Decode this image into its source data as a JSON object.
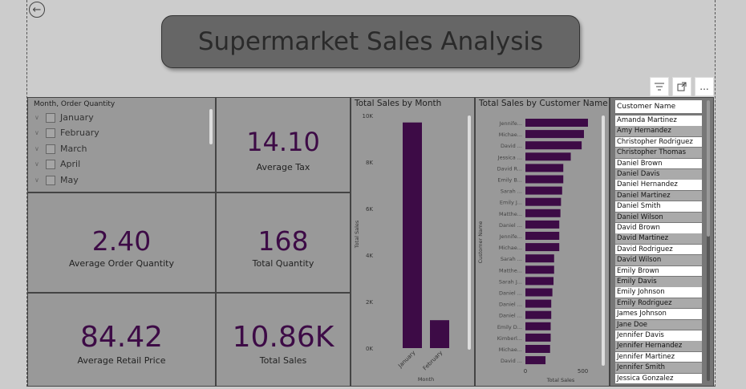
{
  "title": "Supermarket Sales Analysis",
  "header_tools": {
    "filter_icon": "filter-icon",
    "focus_icon": "focus-mode-icon",
    "more_icon": "ellipsis-icon",
    "more_label": "..."
  },
  "back_icon": "back-arrow-icon",
  "slicer": {
    "title": "Month, Order Quantity",
    "items": [
      "January",
      "February",
      "March",
      "April",
      "May"
    ]
  },
  "kpis": {
    "avg_tax": {
      "value": "14.10",
      "label": "Average Tax"
    },
    "avg_order_qty": {
      "value": "2.40",
      "label": "Average Order Quantity"
    },
    "total_qty": {
      "value": "168",
      "label": "Total Quantity"
    },
    "avg_retail_price": {
      "value": "84.42",
      "label": "Average Retail Price"
    },
    "total_sales": {
      "value": "10.86K",
      "label": "Total Sales"
    }
  },
  "colors": {
    "bar": "#3d0b46",
    "tile": "#999999",
    "background": "#cccccc"
  },
  "chart_data": [
    {
      "type": "bar",
      "title": "Total Sales by Month",
      "xlabel": "Month",
      "ylabel": "Total Sales",
      "categories": [
        "January",
        "February"
      ],
      "values": [
        9700,
        1200
      ],
      "yticks": [
        "0K",
        "2K",
        "4K",
        "6K",
        "8K",
        "10K"
      ],
      "ylim": [
        0,
        10000
      ],
      "grid": false
    },
    {
      "type": "bar",
      "orientation": "horizontal",
      "title": "Total Sales by Customer Name",
      "xlabel": "Total Sales",
      "ylabel": "Customer Name",
      "categories": [
        "Jennife...",
        "Michae...",
        "David ...",
        "Jessica ...",
        "David R...",
        "Emily B...",
        "Sarah ...",
        "Emily J...",
        "Matthe...",
        "Daniel ...",
        "Jennife...",
        "Michae...",
        "Sarah ...",
        "Matthe...",
        "Sarah J...",
        "Daniel ...",
        "Daniel ...",
        "Daniel ...",
        "Emily D...",
        "Kimberl...",
        "Michae...",
        "David ..."
      ],
      "values": [
        545,
        510,
        490,
        395,
        330,
        330,
        320,
        310,
        305,
        295,
        295,
        295,
        250,
        250,
        245,
        235,
        225,
        225,
        220,
        220,
        215,
        175
      ],
      "xticks": [
        "0",
        "500"
      ],
      "xlim": [
        0,
        580
      ],
      "grid": false
    }
  ],
  "table": {
    "header": "Customer Name",
    "rows": [
      "Amanda Martinez",
      "Amy Hernandez",
      "Christopher Rodriguez",
      "Christopher Thomas",
      "Daniel Brown",
      "Daniel Davis",
      "Daniel Hernandez",
      "Daniel Martinez",
      "Daniel Smith",
      "Daniel Wilson",
      "David Brown",
      "David Martinez",
      "David Rodriguez",
      "David Wilson",
      "Emily Brown",
      "Emily Davis",
      "Emily Johnson",
      "Emily Rodriguez",
      "James Johnson",
      "Jane Doe",
      "Jennifer Davis",
      "Jennifer Hernandez",
      "Jennifer Martinez",
      "Jennifer Smith",
      "Jessica Gonzalez"
    ]
  }
}
